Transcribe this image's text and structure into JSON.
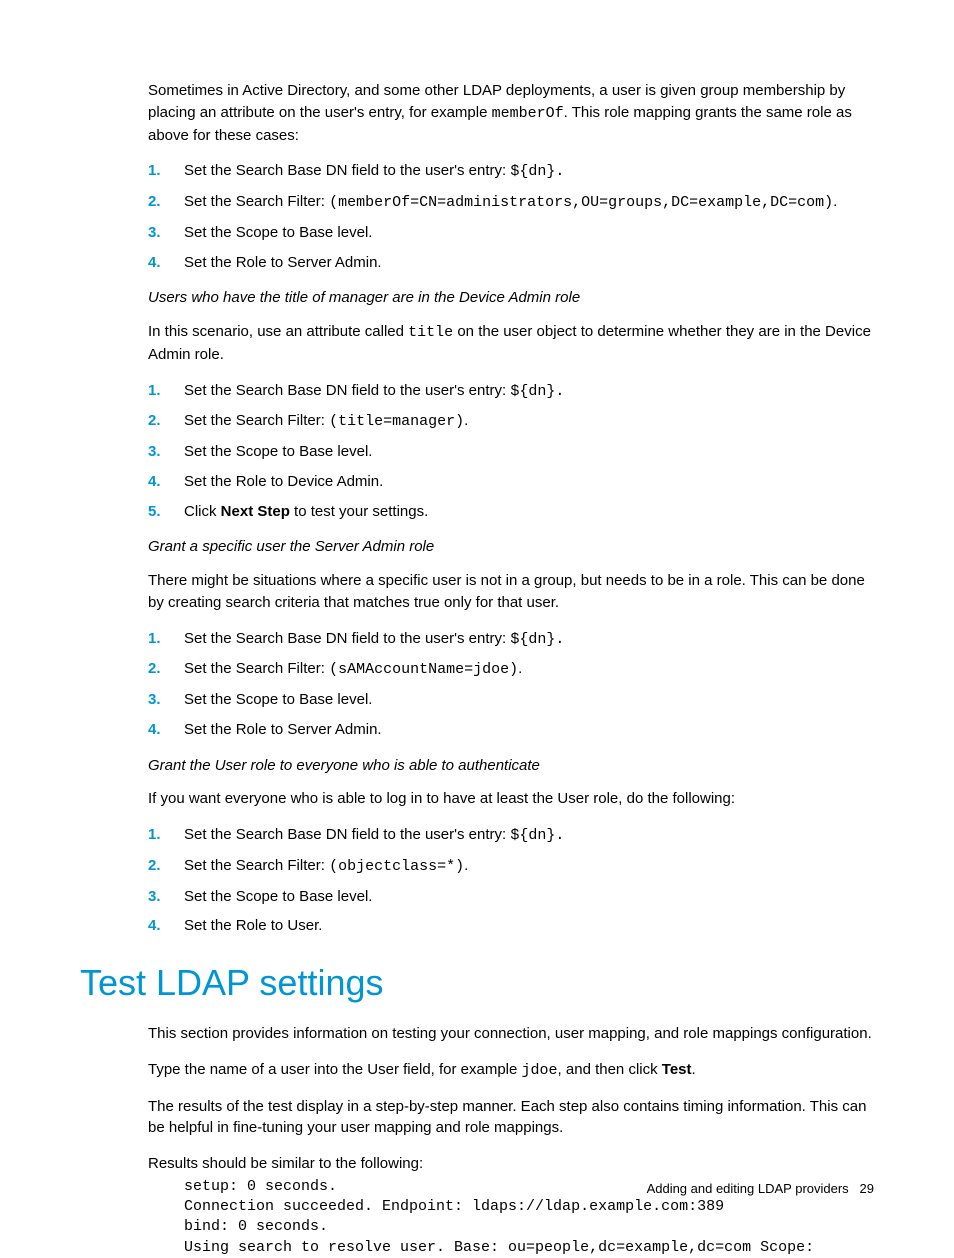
{
  "intro_para": {
    "pre": "Sometimes in Active Directory, and some other LDAP deployments, a user is given group membership by placing an attribute on the user's entry, for example ",
    "code": "memberOf",
    "post": ". This role mapping grants the same role as above for these cases:"
  },
  "list1": {
    "items": [
      {
        "n": "1.",
        "pre": "Set the Search Base DN field to the user's entry: ",
        "code": "${dn}.",
        "post": ""
      },
      {
        "n": "2.",
        "pre": "Set the Search Filter: ",
        "code": "(memberOf=CN=administrators,OU=groups,DC=example,DC=com)",
        "post": "."
      },
      {
        "n": "3.",
        "pre": "Set the Scope to Base level.",
        "code": "",
        "post": ""
      },
      {
        "n": "4.",
        "pre": "Set the Role to Server Admin.",
        "code": "",
        "post": ""
      }
    ]
  },
  "sub2": "Users who have the title of manager are in the Device Admin role",
  "para2": {
    "pre": "In this scenario, use an attribute called ",
    "code": "title",
    "post": " on the user object to determine whether they are in the Device Admin role."
  },
  "list2": {
    "items": [
      {
        "n": "1.",
        "pre": "Set the Search Base DN field to the user's entry: ",
        "code": "${dn}.",
        "post": ""
      },
      {
        "n": "2.",
        "pre": "Set the Search Filter: ",
        "code": "(title=manager)",
        "post": "."
      },
      {
        "n": "3.",
        "pre": "Set the Scope to Base level.",
        "code": "",
        "post": ""
      },
      {
        "n": "4.",
        "pre": "Set the Role to Device Admin.",
        "code": "",
        "post": ""
      },
      {
        "n": "5.",
        "pre": "Click ",
        "bold": "Next Step",
        "post2": " to test your settings."
      }
    ]
  },
  "sub3": "Grant a specific user the Server Admin role",
  "para3": "There might be situations where a specific user is not in a group, but needs to be in a role. This can be done by creating search criteria that matches true only for that user.",
  "list3": {
    "items": [
      {
        "n": "1.",
        "pre": "Set the Search Base DN field to the user's entry: ",
        "code": "${dn}.",
        "post": ""
      },
      {
        "n": "2.",
        "pre": "Set the Search Filter: ",
        "code": "(sAMAccountName=jdoe)",
        "post": "."
      },
      {
        "n": "3.",
        "pre": "Set the Scope to Base level.",
        "code": "",
        "post": ""
      },
      {
        "n": "4.",
        "pre": "Set the Role to Server Admin.",
        "code": "",
        "post": ""
      }
    ]
  },
  "sub4": "Grant the User role to everyone who is able to authenticate",
  "para4": "If you want everyone who is able to log in to have at least the User role, do the following:",
  "list4": {
    "items": [
      {
        "n": "1.",
        "pre": "Set the Search Base DN field to the user's entry: ",
        "code": "${dn}.",
        "post": ""
      },
      {
        "n": "2.",
        "pre": "Set the Search Filter: ",
        "code": "(objectclass=*)",
        "post": "."
      },
      {
        "n": "3.",
        "pre": "Set the Scope to Base level.",
        "code": "",
        "post": ""
      },
      {
        "n": "4.",
        "pre": "Set the Role to User.",
        "code": "",
        "post": ""
      }
    ]
  },
  "heading1": "Test LDAP settings",
  "para5": "This section provides information on testing your connection, user mapping, and role mappings configuration.",
  "para6": {
    "pre": "Type the name of a user into the User field, for example ",
    "code": " jdoe",
    "post": ", and then click ",
    "bold": "Test",
    "post2": "."
  },
  "para7": "The results of the test display in a step-by-step manner. Each step also contains timing information. This can be helpful in fine-tuning your user mapping and role mappings.",
  "para8": "Results should be similar to the following:",
  "codeblock": "setup: 0 seconds.\nConnection succeeded. Endpoint: ldaps://ldap.example.com:389\nbind: 0 seconds.\nUsing search to resolve user. Base: ou=people,dc=example,dc=com Scope:",
  "footer": {
    "text": "Adding and editing LDAP providers",
    "page": "29"
  }
}
